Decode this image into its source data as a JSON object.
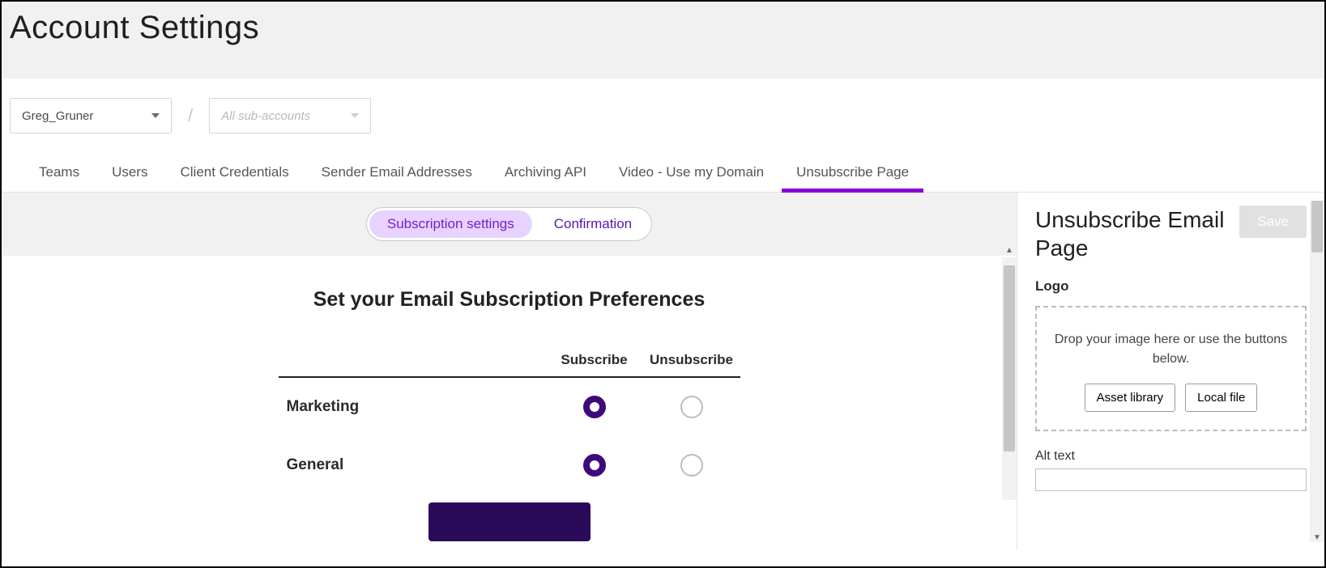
{
  "page_title": "Account Settings",
  "account_selector": {
    "selected": "Greg_Gruner",
    "separator": "/",
    "sub_placeholder": "All sub-accounts"
  },
  "tabs": [
    {
      "label": "Teams",
      "active": false
    },
    {
      "label": "Users",
      "active": false
    },
    {
      "label": "Client Credentials",
      "active": false
    },
    {
      "label": "Sender Email Addresses",
      "active": false
    },
    {
      "label": "Archiving API",
      "active": false
    },
    {
      "label": "Video - Use my Domain",
      "active": false
    },
    {
      "label": "Unsubscribe Page",
      "active": true
    }
  ],
  "segmented": {
    "option_a": "Subscription settings",
    "option_b": "Confirmation",
    "active": "option_a"
  },
  "preview": {
    "heading": "Set your Email Subscription Preferences",
    "columns": {
      "subscribe": "Subscribe",
      "unsubscribe": "Unsubscribe"
    },
    "rows": [
      {
        "label": "Marketing",
        "selected": "subscribe"
      },
      {
        "label": "General",
        "selected": "subscribe"
      }
    ]
  },
  "side_panel": {
    "title": "Unsubscribe Email Page",
    "save_label": "Save",
    "logo_label": "Logo",
    "dropzone_hint": "Drop your image here or use the buttons below.",
    "btn_asset": "Asset library",
    "btn_local": "Local file",
    "alt_label": "Alt text"
  }
}
